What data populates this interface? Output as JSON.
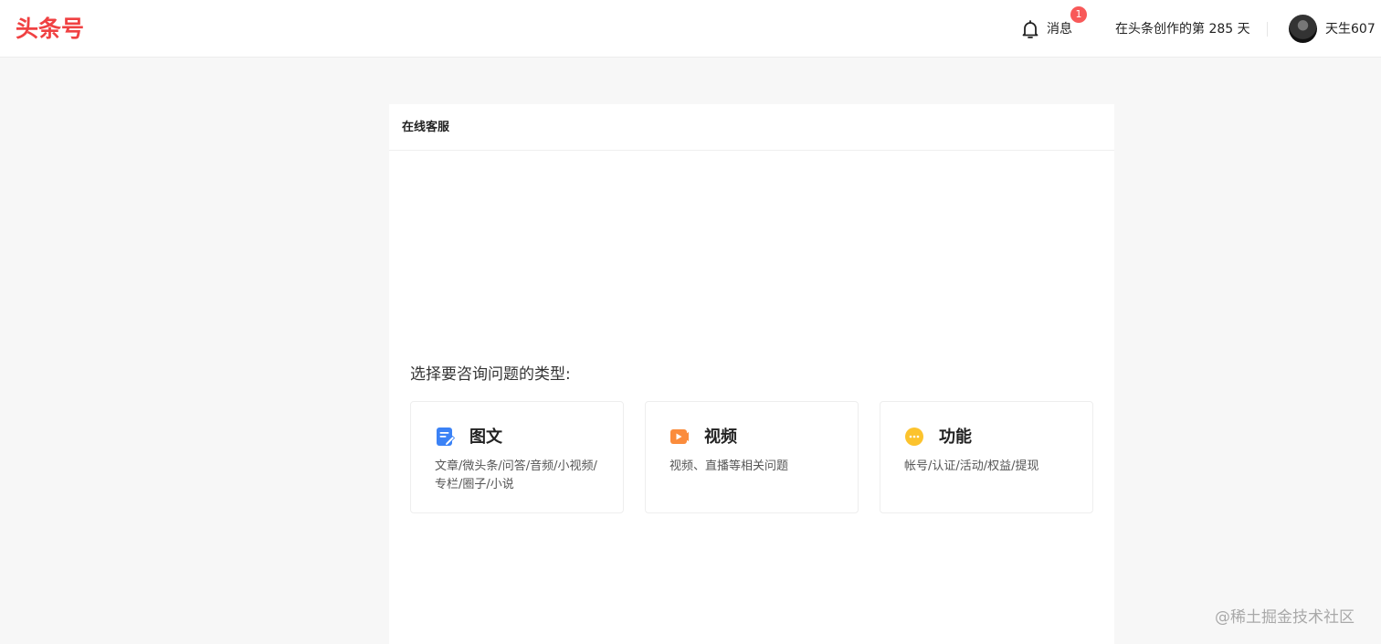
{
  "header": {
    "logo": "头条号",
    "notification_label": "消息",
    "notification_count": "1",
    "creation_days": "在头条创作的第 285 天",
    "username": "天生607"
  },
  "panel": {
    "title": "在线客服",
    "prompt": "选择要咨询问题的类型:",
    "cards": [
      {
        "title": "图文",
        "desc": "文章/微头条/问答/音频/小视频/专栏/圈子/小说",
        "icon": "article-icon",
        "color": "#3b82f6"
      },
      {
        "title": "视频",
        "desc": "视频、直播等相关问题",
        "icon": "video-icon",
        "color": "#fb8c3c"
      },
      {
        "title": "功能",
        "desc": "帐号/认证/活动/权益/提现",
        "icon": "more-icon",
        "color": "#fcc32d"
      }
    ]
  },
  "watermark": "@稀土掘金技术社区"
}
